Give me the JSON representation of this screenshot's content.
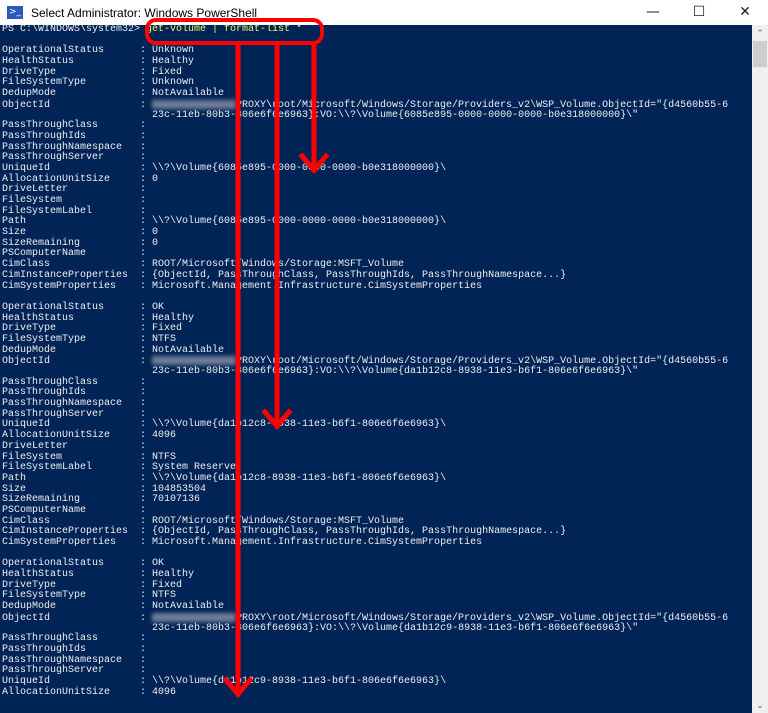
{
  "window": {
    "title": "Select Administrator: Windows PowerShell",
    "minimize": "—",
    "maximize": "☐",
    "close": "✕"
  },
  "console": {
    "prompt": "PS C:\\WINDOWS\\system32> ",
    "command": "get-volume | format-list *",
    "volumes": [
      [
        [
          "OperationalStatus",
          "Unknown"
        ],
        [
          "HealthStatus",
          "Healthy"
        ],
        [
          "DriveType",
          "Fixed"
        ],
        [
          "FileSystemType",
          "Unknown"
        ],
        [
          "DedupMode",
          "NotAvailable"
        ],
        [
          "ObjectId",
          "PROXY\\root/Microsoft/Windows/Storage/Providers_v2\\WSP_Volume.ObjectId=\"{d4560b55-6",
          "blur"
        ],
        [
          "",
          "23c-11eb-80b3-806e6f6e6963}:VO:\\\\?\\Volume{6085e895-0000-0000-0000-b0e318000000}\\\""
        ],
        [
          "PassThroughClass",
          ""
        ],
        [
          "PassThroughIds",
          ""
        ],
        [
          "PassThroughNamespace",
          ""
        ],
        [
          "PassThroughServer",
          ""
        ],
        [
          "UniqueId",
          "\\\\?\\Volume{6085e895-0000-0000-0000-b0e318000000}\\"
        ],
        [
          "AllocationUnitSize",
          "0"
        ],
        [
          "DriveLetter",
          ""
        ],
        [
          "FileSystem",
          ""
        ],
        [
          "FileSystemLabel",
          ""
        ],
        [
          "Path",
          "\\\\?\\Volume{6085e895-0000-0000-0000-b0e318000000}\\"
        ],
        [
          "Size",
          "0"
        ],
        [
          "SizeRemaining",
          "0"
        ],
        [
          "PSComputerName",
          ""
        ],
        [
          "CimClass",
          "ROOT/Microsoft/Windows/Storage:MSFT_Volume"
        ],
        [
          "CimInstanceProperties",
          "{ObjectId, PassThroughClass, PassThroughIds, PassThroughNamespace...}"
        ],
        [
          "CimSystemProperties",
          "Microsoft.Management.Infrastructure.CimSystemProperties"
        ]
      ],
      [
        [
          "OperationalStatus",
          "OK"
        ],
        [
          "HealthStatus",
          "Healthy"
        ],
        [
          "DriveType",
          "Fixed"
        ],
        [
          "FileSystemType",
          "NTFS"
        ],
        [
          "DedupMode",
          "NotAvailable"
        ],
        [
          "ObjectId",
          "PROXY\\root/Microsoft/Windows/Storage/Providers_v2\\WSP_Volume.ObjectId=\"{d4560b55-6",
          "blur"
        ],
        [
          "",
          "23c-11eb-80b3-806e6f6e6963}:VO:\\\\?\\Volume{da1b12c8-8938-11e3-b6f1-806e6f6e6963}\\\""
        ],
        [
          "PassThroughClass",
          ""
        ],
        [
          "PassThroughIds",
          ""
        ],
        [
          "PassThroughNamespace",
          ""
        ],
        [
          "PassThroughServer",
          ""
        ],
        [
          "UniqueId",
          "\\\\?\\Volume{da1b12c8-8938-11e3-b6f1-806e6f6e6963}\\"
        ],
        [
          "AllocationUnitSize",
          "4096"
        ],
        [
          "DriveLetter",
          ""
        ],
        [
          "FileSystem",
          "NTFS"
        ],
        [
          "FileSystemLabel",
          "System Reserve"
        ],
        [
          "Path",
          "\\\\?\\Volume{da1b12c8-8938-11e3-b6f1-806e6f6e6963}\\"
        ],
        [
          "Size",
          "104853504"
        ],
        [
          "SizeRemaining",
          "70107136"
        ],
        [
          "PSComputerName",
          ""
        ],
        [
          "CimClass",
          "ROOT/Microsoft/Windows/Storage:MSFT_Volume"
        ],
        [
          "CimInstanceProperties",
          "{ObjectId, PassThroughClass, PassThroughIds, PassThroughNamespace...}"
        ],
        [
          "CimSystemProperties",
          "Microsoft.Management.Infrastructure.CimSystemProperties"
        ]
      ],
      [
        [
          "OperationalStatus",
          "OK"
        ],
        [
          "HealthStatus",
          "Healthy"
        ],
        [
          "DriveType",
          "Fixed"
        ],
        [
          "FileSystemType",
          "NTFS"
        ],
        [
          "DedupMode",
          "NotAvailable"
        ],
        [
          "ObjectId",
          "PROXY\\root/Microsoft/Windows/Storage/Providers_v2\\WSP_Volume.ObjectId=\"{d4560b55-6",
          "blur"
        ],
        [
          "",
          "23c-11eb-80b3-806e6f6e6963}:VO:\\\\?\\Volume{da1b12c9-8938-11e3-b6f1-806e6f6e6963}\\\""
        ],
        [
          "PassThroughClass",
          ""
        ],
        [
          "PassThroughIds",
          ""
        ],
        [
          "PassThroughNamespace",
          ""
        ],
        [
          "PassThroughServer",
          ""
        ],
        [
          "UniqueId",
          "\\\\?\\Volume{da1b12c9-8938-11e3-b6f1-806e6f6e6963}\\"
        ],
        [
          "AllocationUnitSize",
          "4096"
        ]
      ]
    ]
  },
  "colors": {
    "console_bg": "#012456",
    "console_text": "#eeedf0",
    "command": "#f3f36a",
    "annotation": "#ff0000"
  },
  "scrollbar": {
    "up": "⌃",
    "down": "⌄"
  }
}
